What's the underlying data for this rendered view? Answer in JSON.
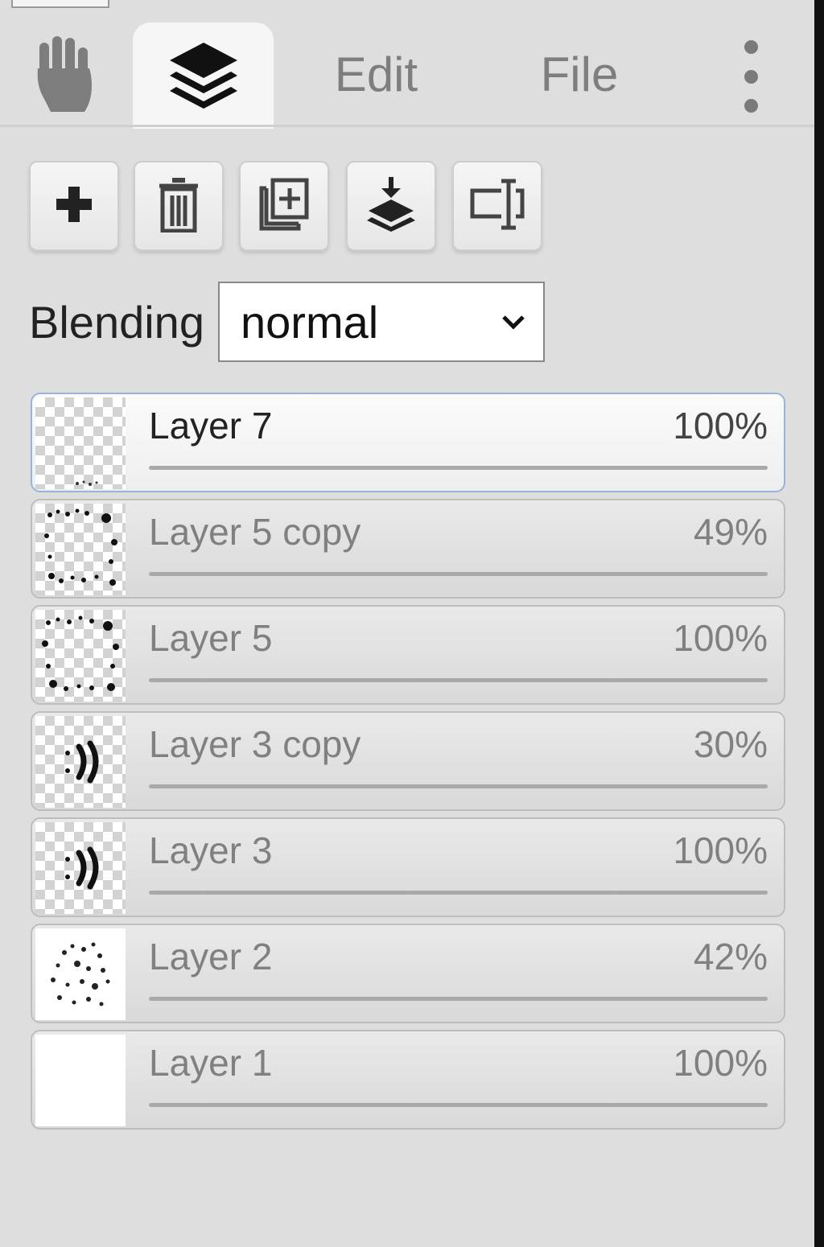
{
  "tabs": [
    {
      "icon": "hand-icon",
      "label": ""
    },
    {
      "icon": "layers-icon",
      "label": "",
      "active": true
    },
    {
      "label": "Edit"
    },
    {
      "label": "File"
    },
    {
      "icon": "more-vertical-icon",
      "label": ""
    }
  ],
  "toolbar": [
    {
      "icon": "plus-icon",
      "action": "add-layer"
    },
    {
      "icon": "trash-icon",
      "action": "delete-layer"
    },
    {
      "icon": "duplicate-icon",
      "action": "duplicate-layer"
    },
    {
      "icon": "merge-down-icon",
      "action": "merge-down"
    },
    {
      "icon": "rename-icon",
      "action": "rename-layer"
    }
  ],
  "blending": {
    "label": "Blending",
    "value": "normal"
  },
  "layers": [
    {
      "name": "Layer 7",
      "opacity_label": "100%",
      "opacity": 1.0,
      "selected": true
    },
    {
      "name": "Layer 5 copy",
      "opacity_label": "49%",
      "opacity": 0.49
    },
    {
      "name": "Layer 5",
      "opacity_label": "100%",
      "opacity": 1.0
    },
    {
      "name": "Layer 3 copy",
      "opacity_label": "30%",
      "opacity": 0.3
    },
    {
      "name": "Layer 3",
      "opacity_label": "100%",
      "opacity": 1.0
    },
    {
      "name": "Layer 2",
      "opacity_label": "42%",
      "opacity": 0.42
    },
    {
      "name": "Layer 1",
      "opacity_label": "100%",
      "opacity": 1.0
    }
  ],
  "colors": {
    "selected_border": "#98b3dc",
    "background": "#dedede"
  }
}
